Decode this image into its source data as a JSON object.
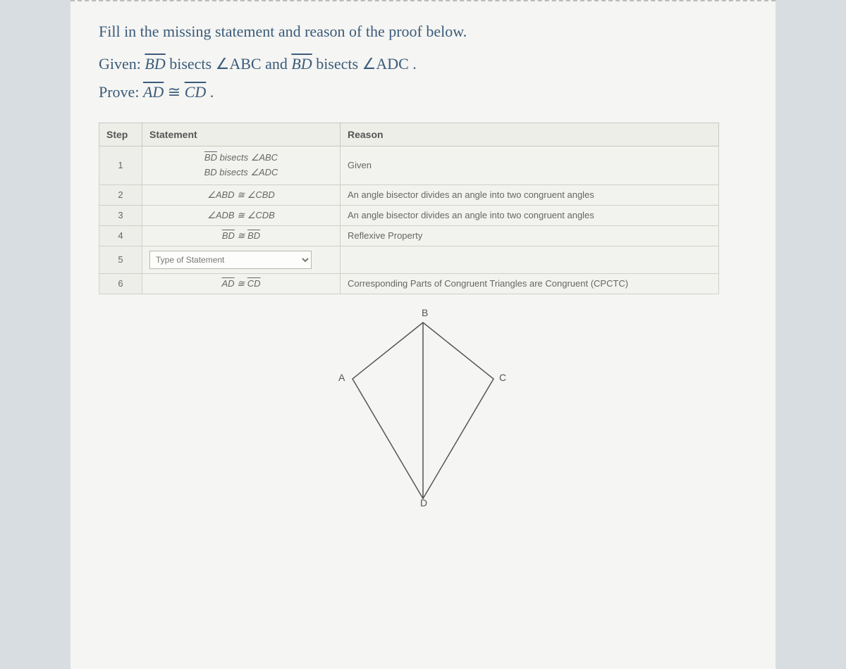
{
  "instruction": "Fill in the missing statement and reason of the proof below.",
  "given_prefix": "Given: ",
  "given_html_parts": {
    "bd": "BD",
    "bisects": " bisects ",
    "abc": "ABC",
    "and": " and ",
    "adc": "ADC",
    "period": "."
  },
  "prove_prefix": "Prove: ",
  "prove_parts": {
    "ad": "AD",
    "cd": "CD",
    "period": "."
  },
  "headers": {
    "step": "Step",
    "statement": "Statement",
    "reason": "Reason"
  },
  "rows": [
    {
      "step": "1",
      "statement_lines": [
        {
          "seg": "BD",
          "text": " bisects ",
          "ang": "ABC"
        },
        {
          "seg": "BD",
          "plain": true,
          "text": " bisects ",
          "ang": "ADC"
        }
      ],
      "reason": "Given"
    },
    {
      "step": "2",
      "statement_cong": {
        "left_ang": "ABD",
        "right_ang": "CBD"
      },
      "reason": "An angle bisector divides an angle into two congruent angles"
    },
    {
      "step": "3",
      "statement_cong": {
        "left_ang": "ADB",
        "right_ang": "CDB"
      },
      "reason": "An angle bisector divides an angle into two congruent angles"
    },
    {
      "step": "4",
      "statement_cong": {
        "left_seg": "BD",
        "right_seg": "BD"
      },
      "reason": "Reflexive Property"
    },
    {
      "step": "5",
      "dropdown_placeholder": "Type of Statement",
      "reason": ""
    },
    {
      "step": "6",
      "statement_cong": {
        "left_seg": "AD",
        "right_seg": "CD"
      },
      "reason": "Corresponding Parts of Congruent Triangles are Congruent (CPCTC)"
    }
  ],
  "diagram": {
    "A": "A",
    "B": "B",
    "C": "C",
    "D": "D"
  }
}
